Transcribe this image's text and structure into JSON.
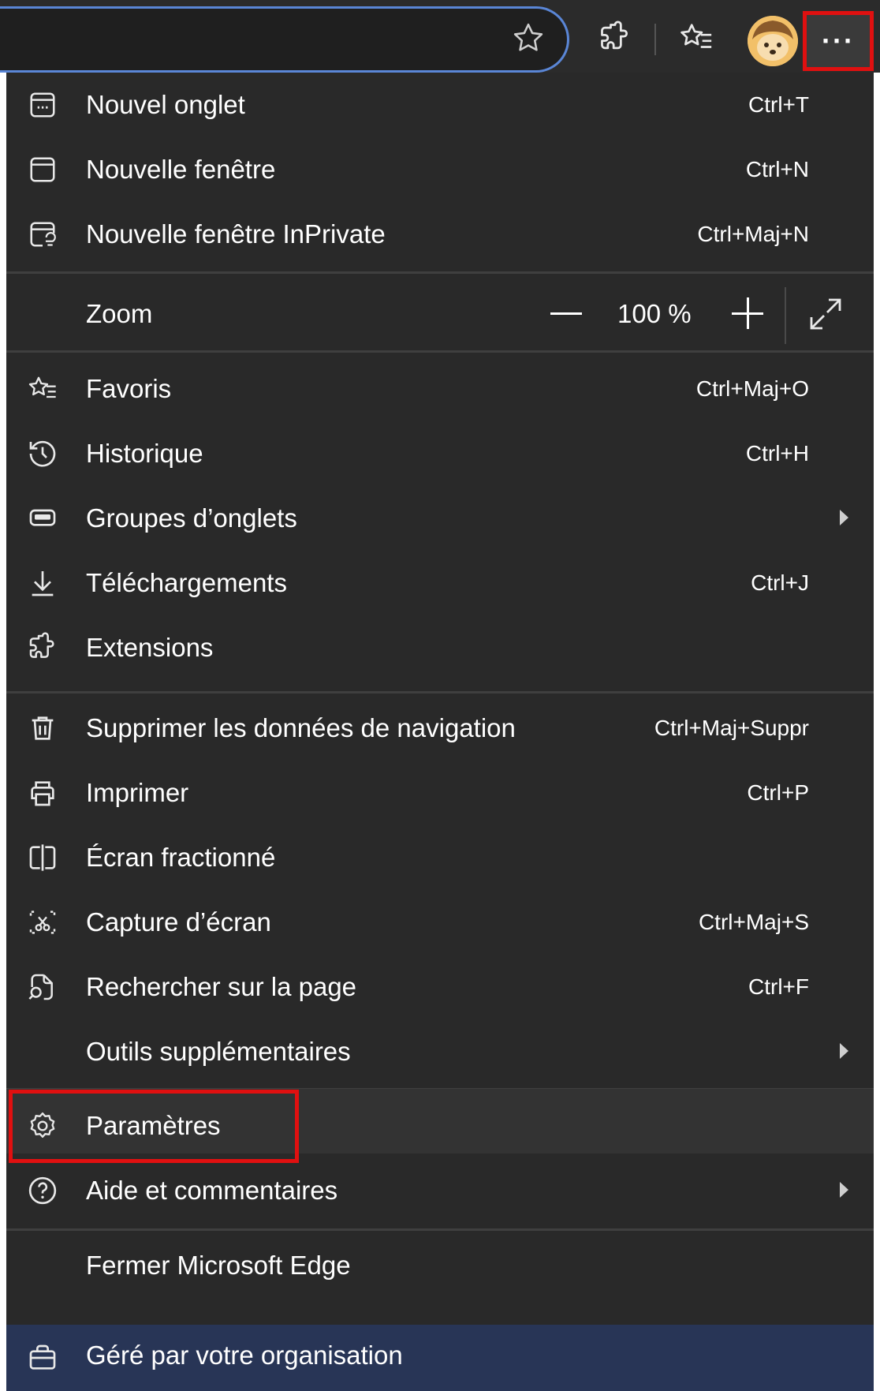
{
  "toolbar": {
    "icons": [
      "star-outline-icon",
      "extensions-icon",
      "favorites-icon",
      "profile-avatar",
      "more-icon"
    ],
    "more_label": "···"
  },
  "menu": {
    "new_tab": {
      "label": "Nouvel onglet",
      "shortcut": "Ctrl+T"
    },
    "new_window": {
      "label": "Nouvelle fenêtre",
      "shortcut": "Ctrl+N"
    },
    "inprivate": {
      "label": "Nouvelle fenêtre InPrivate",
      "shortcut": "Ctrl+Maj+N"
    },
    "zoom": {
      "label": "Zoom",
      "value": "100 %"
    },
    "favorites": {
      "label": "Favoris",
      "shortcut": "Ctrl+Maj+O"
    },
    "history": {
      "label": "Historique",
      "shortcut": "Ctrl+H"
    },
    "tab_groups": {
      "label": "Groupes d’onglets"
    },
    "downloads": {
      "label": "Téléchargements",
      "shortcut": "Ctrl+J"
    },
    "extensions": {
      "label": "Extensions"
    },
    "clear_data": {
      "label": "Supprimer les données de navigation",
      "shortcut": "Ctrl+Maj+Suppr"
    },
    "print": {
      "label": "Imprimer",
      "shortcut": "Ctrl+P"
    },
    "split_screen": {
      "label": "Écran fractionné"
    },
    "screenshot": {
      "label": "Capture d’écran",
      "shortcut": "Ctrl+Maj+S"
    },
    "find": {
      "label": "Rechercher sur la page",
      "shortcut": "Ctrl+F"
    },
    "more_tools": {
      "label": "Outils supplémentaires"
    },
    "settings": {
      "label": "Paramètres"
    },
    "help": {
      "label": "Aide et commentaires"
    },
    "close_edge": {
      "label": "Fermer Microsoft Edge"
    },
    "managed": {
      "label": "Géré par votre organisation"
    }
  },
  "colors": {
    "menu_bg": "#292929",
    "toolbar_bg": "#2b2b2b",
    "managed_bg": "#283556",
    "highlight_border": "#e01010",
    "address_border": "#5a86d6"
  }
}
